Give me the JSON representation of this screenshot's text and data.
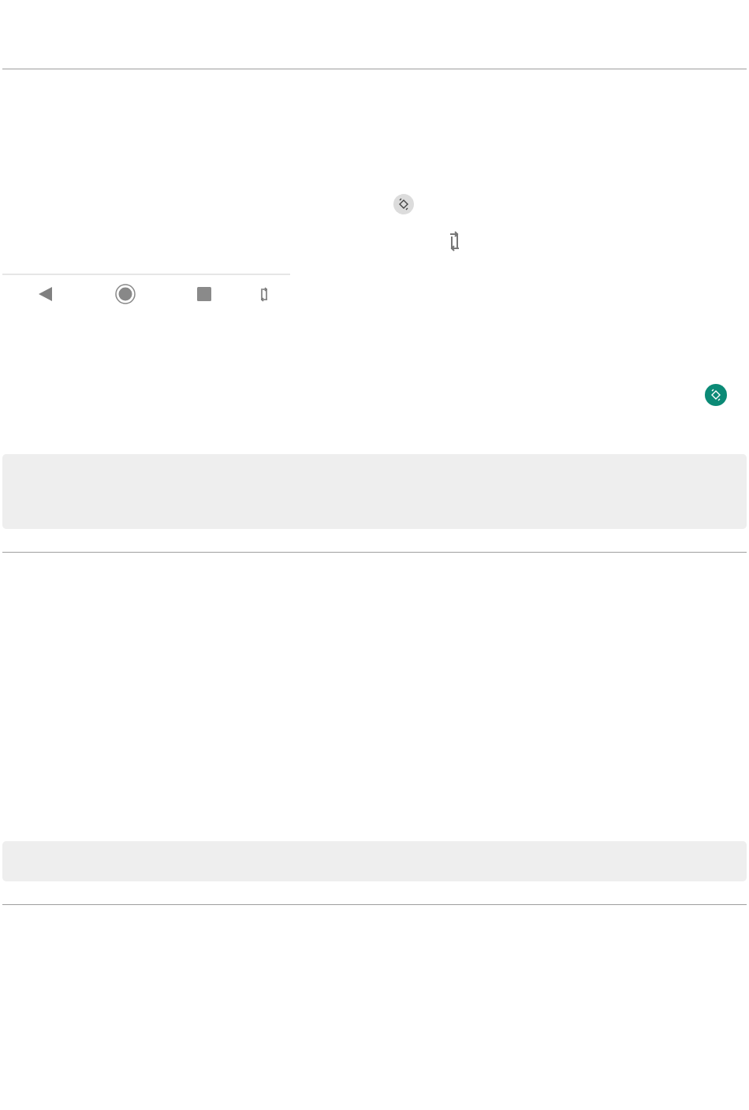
{
  "blocks": [
    {
      "kind": "rule"
    },
    {
      "kind": "rotate-chip"
    },
    {
      "kind": "rotate-glyph"
    },
    {
      "kind": "nav-bar",
      "buttons": [
        {
          "kind": "back"
        },
        {
          "kind": "home"
        },
        {
          "kind": "recents"
        },
        {
          "kind": "rotate"
        }
      ]
    },
    {
      "kind": "rotate-fab"
    },
    {
      "kind": "note-tall"
    },
    {
      "kind": "rule"
    },
    {
      "kind": "note-short"
    },
    {
      "kind": "rule"
    }
  ]
}
